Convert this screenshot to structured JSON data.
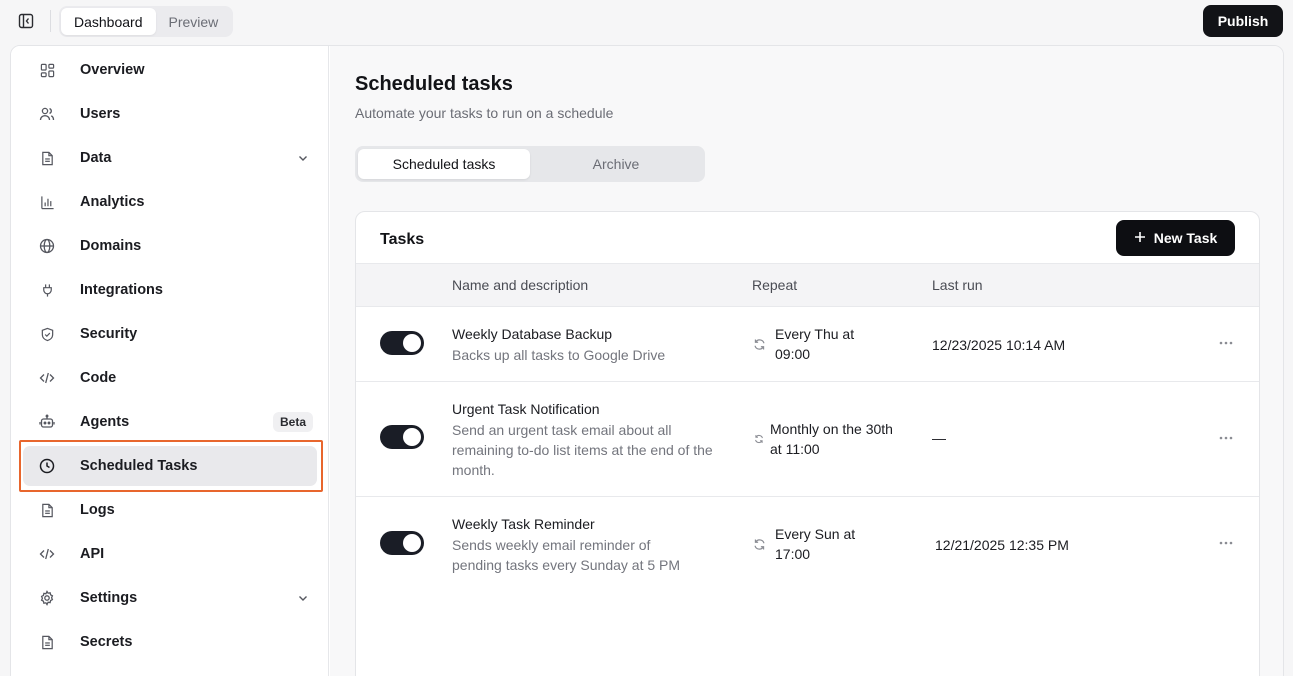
{
  "topbar": {
    "mode_tabs": [
      {
        "label": "Dashboard",
        "active": true
      },
      {
        "label": "Preview",
        "active": false
      }
    ],
    "publish_label": "Publish"
  },
  "sidebar": {
    "items": [
      {
        "label": "Overview",
        "icon": "grid-icon"
      },
      {
        "label": "Users",
        "icon": "users-icon"
      },
      {
        "label": "Data",
        "icon": "document-icon",
        "expandable": true
      },
      {
        "label": "Analytics",
        "icon": "bar-chart-icon"
      },
      {
        "label": "Domains",
        "icon": "globe-icon"
      },
      {
        "label": "Integrations",
        "icon": "plug-icon"
      },
      {
        "label": "Security",
        "icon": "shield-icon"
      },
      {
        "label": "Code",
        "icon": "code-icon"
      },
      {
        "label": "Agents",
        "icon": "bot-icon",
        "badge": "Beta"
      },
      {
        "label": "Scheduled Tasks",
        "icon": "clock-icon",
        "active": true
      },
      {
        "label": "Logs",
        "icon": "document-icon"
      },
      {
        "label": "API",
        "icon": "code-icon"
      },
      {
        "label": "Settings",
        "icon": "gear-icon",
        "expandable": true
      },
      {
        "label": "Secrets",
        "icon": "document-icon"
      }
    ]
  },
  "page": {
    "title": "Scheduled tasks",
    "subtitle": "Automate your tasks to run on a schedule",
    "tabs": [
      {
        "label": "Scheduled tasks",
        "active": true
      },
      {
        "label": "Archive",
        "active": false
      }
    ]
  },
  "tasks_card": {
    "title": "Tasks",
    "new_task_label": "New Task",
    "columns": [
      "Name and description",
      "Repeat",
      "Last run"
    ],
    "rows": [
      {
        "enabled": true,
        "name": "Weekly Database Backup",
        "description": "Backs up all tasks to Google Drive",
        "repeat": "Every Thu at 09:00",
        "last_run": "12/23/2025 10:14 AM"
      },
      {
        "enabled": true,
        "name": "Urgent Task Notification",
        "description": "Send an urgent task email about all remaining to-do list items at the end of the month.",
        "repeat": "Monthly on the 30th at 11:00",
        "last_run": "—"
      },
      {
        "enabled": true,
        "name": "Weekly Task Reminder",
        "description": "Sends weekly email reminder of pending tasks every Sunday at 5 PM",
        "repeat": "Every Sun at 17:00",
        "last_run": "12/21/2025 12:35 PM"
      }
    ]
  },
  "colors": {
    "accent_dark": "#121317",
    "highlight": "#e8662d"
  }
}
